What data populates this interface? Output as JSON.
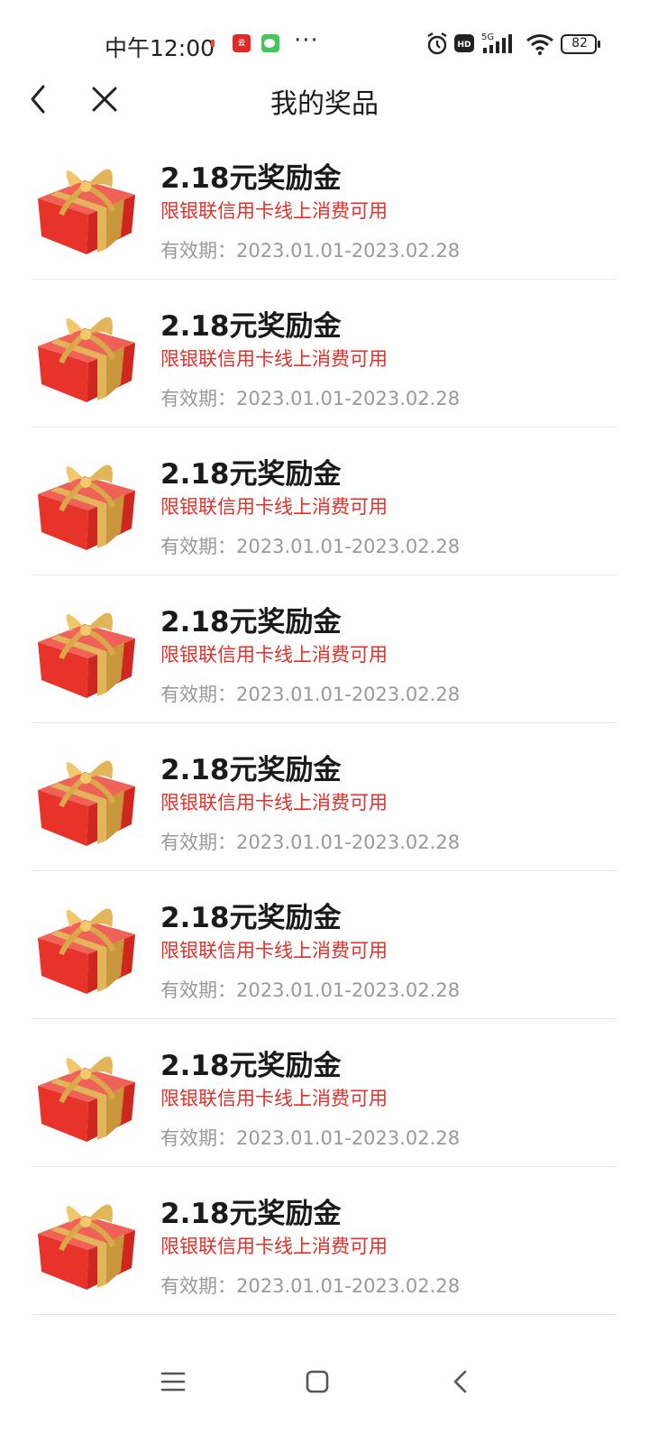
{
  "status_bar": {
    "time": "中午12:00",
    "more": "···",
    "network": "5G",
    "battery": "82"
  },
  "header": {
    "title": "我的奖品"
  },
  "prizes": [
    {
      "title": "2.18元奖励金",
      "desc": "限银联信用卡线上消费可用",
      "valid": "有效期：2023.01.01-2023.02.28"
    },
    {
      "title": "2.18元奖励金",
      "desc": "限银联信用卡线上消费可用",
      "valid": "有效期：2023.01.01-2023.02.28"
    },
    {
      "title": "2.18元奖励金",
      "desc": "限银联信用卡线上消费可用",
      "valid": "有效期：2023.01.01-2023.02.28"
    },
    {
      "title": "2.18元奖励金",
      "desc": "限银联信用卡线上消费可用",
      "valid": "有效期：2023.01.01-2023.02.28"
    },
    {
      "title": "2.18元奖励金",
      "desc": "限银联信用卡线上消费可用",
      "valid": "有效期：2023.01.01-2023.02.28"
    },
    {
      "title": "2.18元奖励金",
      "desc": "限银联信用卡线上消费可用",
      "valid": "有效期：2023.01.01-2023.02.28"
    },
    {
      "title": "2.18元奖励金",
      "desc": "限银联信用卡线上消费可用",
      "valid": "有效期：2023.01.01-2023.02.28"
    },
    {
      "title": "2.18元奖励金",
      "desc": "限银联信用卡线上消费可用",
      "valid": "有效期：2023.01.01-2023.02.28"
    }
  ],
  "colors": {
    "accent_red": "#e0302a",
    "muted_gray": "#999999",
    "gift_red": "#e8332a",
    "gift_gold": "#e3b55a"
  },
  "icons": {
    "back": "chevron-left-icon",
    "close": "close-icon",
    "gift": "gift-box-icon",
    "menu": "menu-icon",
    "home": "home-icon",
    "nav_back": "back-icon"
  }
}
